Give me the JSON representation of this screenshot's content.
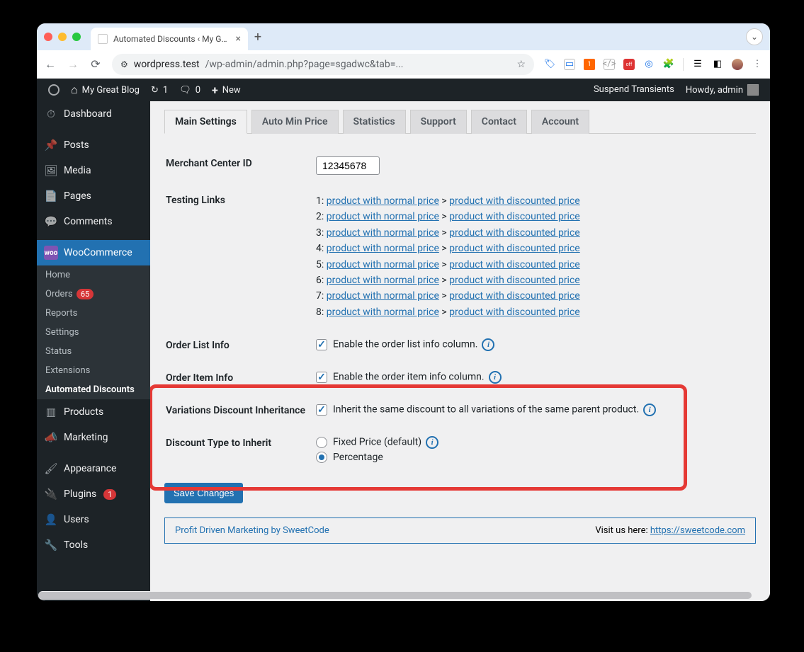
{
  "browser": {
    "tab_title": "Automated Discounts ‹ My G…",
    "url_host": "wordpress.test",
    "url_path": "/wp-admin/admin.php?page=sgadwc&tab=..."
  },
  "adminbar": {
    "site_name": "My Great Blog",
    "updates": "1",
    "comments": "0",
    "new": "New",
    "suspend": "Suspend Transients",
    "howdy": "Howdy, admin"
  },
  "sidebar": {
    "dashboard": "Dashboard",
    "posts": "Posts",
    "media": "Media",
    "pages": "Pages",
    "comments": "Comments",
    "woocommerce": "WooCommerce",
    "woo_sub": {
      "home": "Home",
      "orders": "Orders",
      "orders_badge": "65",
      "reports": "Reports",
      "settings": "Settings",
      "status": "Status",
      "extensions": "Extensions",
      "automated": "Automated Discounts"
    },
    "products": "Products",
    "marketing": "Marketing",
    "appearance": "Appearance",
    "plugins": "Plugins",
    "plugins_badge": "1",
    "users": "Users",
    "tools": "Tools"
  },
  "tabs": {
    "main": "Main Settings",
    "auto": "Auto Min Price",
    "stats": "Statistics",
    "support": "Support",
    "contact": "Contact",
    "account": "Account"
  },
  "form": {
    "merchant_label": "Merchant Center ID",
    "merchant_value": "12345678",
    "testing_label": "Testing Links",
    "testing_rows": [
      {
        "n": "1:",
        "a": "product with normal price",
        "b": "product with discounted price"
      },
      {
        "n": "2:",
        "a": "product with normal price",
        "b": "product with discounted price"
      },
      {
        "n": "3:",
        "a": "product with normal price",
        "b": "product with discounted price"
      },
      {
        "n": "4:",
        "a": "product with normal price",
        "b": "product with discounted price"
      },
      {
        "n": "5:",
        "a": "product with normal price",
        "b": "product with discounted price"
      },
      {
        "n": "6:",
        "a": "product with normal price",
        "b": "product with discounted price"
      },
      {
        "n": "7:",
        "a": "product with normal price",
        "b": "product with discounted price"
      },
      {
        "n": "8:",
        "a": "product with normal price",
        "b": "product with discounted price"
      }
    ],
    "order_list_label": "Order List Info",
    "order_list_text": "Enable the order list info column.",
    "order_item_label": "Order Item Info",
    "order_item_text": "Enable the order item info column.",
    "variations_label": "Variations Discount Inheritance",
    "variations_text": "Inherit the same discount to all variations of the same parent product.",
    "discount_type_label": "Discount Type to Inherit",
    "discount_fixed": "Fixed Price (default)",
    "discount_percentage": "Percentage",
    "save": "Save Changes"
  },
  "footer": {
    "left": "Profit Driven Marketing by SweetCode",
    "right_text": "Visit us here: ",
    "right_link": "https://sweetcode.com"
  }
}
